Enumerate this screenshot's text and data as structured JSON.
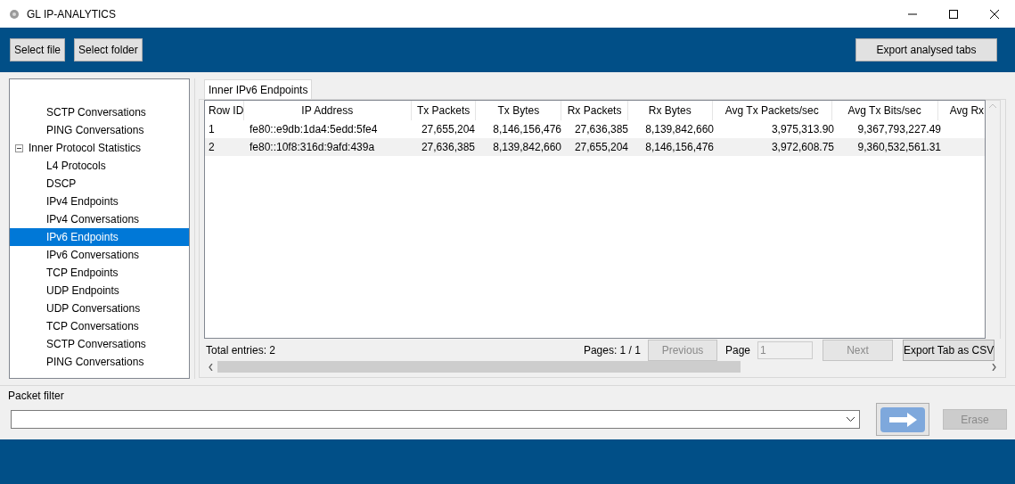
{
  "window": {
    "title": "GL IP-ANALYTICS"
  },
  "toolbar": {
    "left_buttons": [
      "Select file",
      "Select folder"
    ],
    "right_button": "Export analysed tabs"
  },
  "tree": {
    "leading_items": [
      {
        "label": "SCTP Conversations",
        "selected": false
      },
      {
        "label": "PING Conversations",
        "selected": false
      }
    ],
    "groups": [
      {
        "label": "Inner Protocol Statistics",
        "expanded": true,
        "children": [
          {
            "label": "L4 Protocols",
            "selected": false
          },
          {
            "label": "DSCP",
            "selected": false
          },
          {
            "label": "IPv4 Endpoints",
            "selected": false
          },
          {
            "label": "IPv4 Conversations",
            "selected": false
          },
          {
            "label": "IPv6 Endpoints",
            "selected": true
          },
          {
            "label": "IPv6 Conversations",
            "selected": false
          },
          {
            "label": "TCP Endpoints",
            "selected": false
          },
          {
            "label": "UDP Endpoints",
            "selected": false
          },
          {
            "label": "UDP Conversations",
            "selected": false
          },
          {
            "label": "TCP Conversations",
            "selected": false
          },
          {
            "label": "SCTP Conversations",
            "selected": false
          },
          {
            "label": "PING Conversations",
            "selected": false
          }
        ]
      }
    ]
  },
  "tabs": [
    {
      "label": "Inner IPv6 Endpoints",
      "selected": true
    }
  ],
  "table": {
    "columns": [
      "Row ID",
      "IP Address",
      "Tx Packets",
      "Tx Bytes",
      "Rx Packets",
      "Rx Bytes",
      "Avg Tx Packets/sec",
      "Avg Tx Bits/sec",
      "Avg Rx"
    ],
    "rows": [
      [
        "1",
        "fe80::e9db:1da4:5edd:5fe4",
        "27,655,204",
        "8,146,156,476",
        "27,636,385",
        "8,139,842,660",
        "3,975,313.90",
        "9,367,793,227.49"
      ],
      [
        "2",
        "fe80::10f8:316d:9afd:439a",
        "27,636,385",
        "8,139,842,660",
        "27,655,204",
        "8,146,156,476",
        "3,972,608.75",
        "9,360,532,561.31"
      ]
    ]
  },
  "pager": {
    "total": "Total entries: 2",
    "pages": "Pages: 1 / 1",
    "previous": {
      "label": "Previous",
      "disabled": true
    },
    "page_label": "Page",
    "page_value": "1",
    "next": {
      "label": "Next",
      "disabled": true
    },
    "export": "Export Tab as CSV"
  },
  "packet_filter": {
    "label": "Packet filter",
    "erase": {
      "label": "Erase",
      "disabled": true
    }
  }
}
